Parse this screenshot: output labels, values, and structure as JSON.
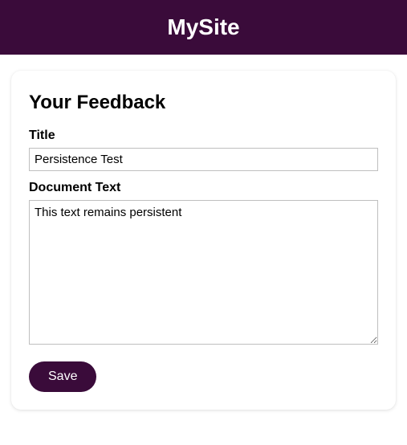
{
  "header": {
    "site_title": "MySite"
  },
  "form": {
    "heading": "Your Feedback",
    "title_label": "Title",
    "title_value": "Persistence Test",
    "doc_label": "Document Text",
    "doc_value": "This text remains persistent",
    "save_label": "Save"
  }
}
